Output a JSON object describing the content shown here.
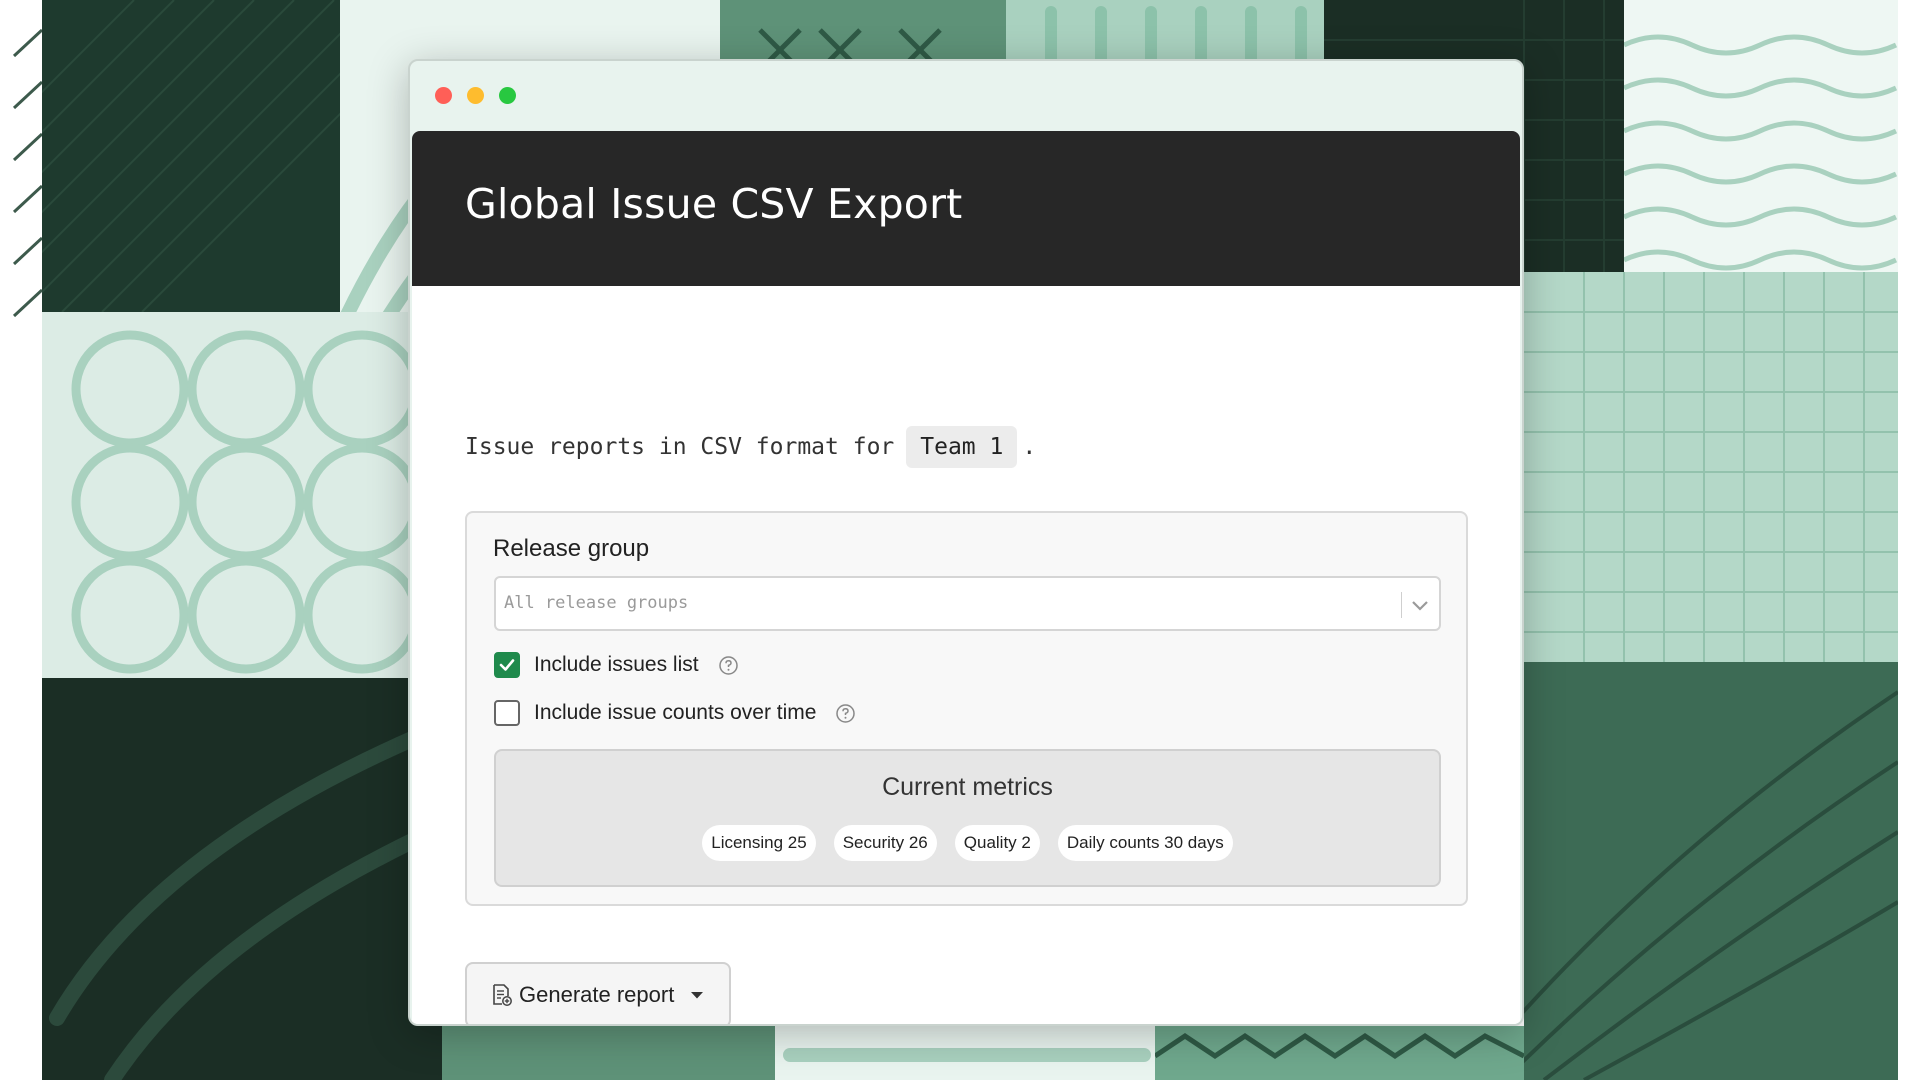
{
  "window": {
    "title": "Global Issue CSV Export"
  },
  "description": {
    "prefix": "Issue reports in CSV format for",
    "team": "Team 1",
    "suffix": "."
  },
  "release_group": {
    "label": "Release group",
    "placeholder": "All release groups"
  },
  "options": [
    {
      "label": "Include issues list",
      "checked": true
    },
    {
      "label": "Include issue counts over time",
      "checked": false
    }
  ],
  "metrics": {
    "title": "Current metrics",
    "chips": [
      "Licensing 25",
      "Security 26",
      "Quality 2",
      "Daily counts 30 days"
    ]
  },
  "actions": {
    "generate_label": "Generate report"
  },
  "colors": {
    "accent": "#1f8a4c",
    "header": "#272727",
    "bg_dark": "#1b2e25",
    "bg_mid": "#3d6b55",
    "bg_light": "#a9d1bf",
    "bg_pale": "#dcece5"
  }
}
